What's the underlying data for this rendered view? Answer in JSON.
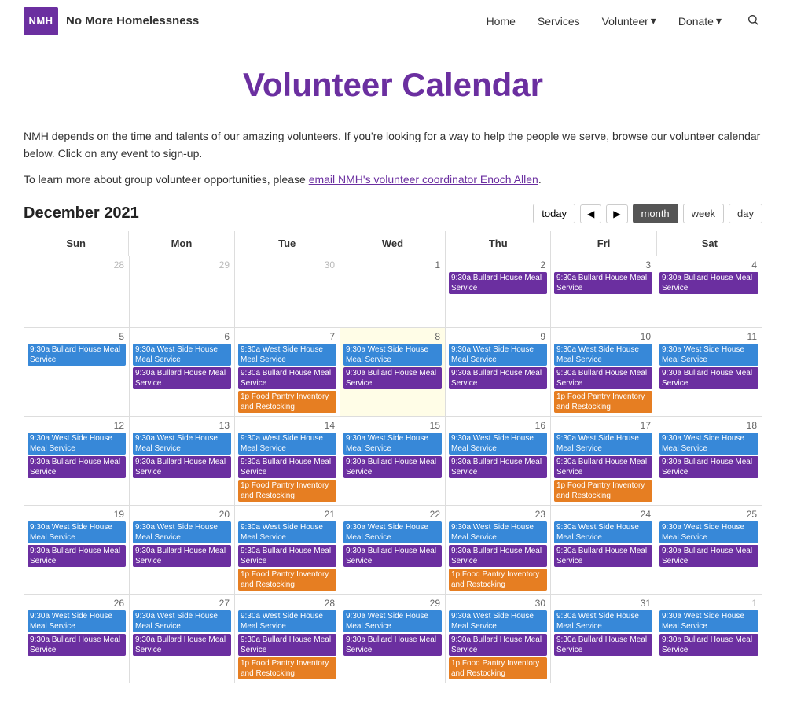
{
  "header": {
    "logo_text": "NMH",
    "site_title": "No More Homelessness",
    "nav": {
      "home": "Home",
      "services": "Services",
      "volunteer": "Volunteer",
      "donate": "Donate"
    }
  },
  "page": {
    "title": "Volunteer Calendar",
    "description1": "NMH depends on the time and talents of our amazing volunteers. If you're looking for a way to help the people we serve, browse our volunteer calendar below. Click on any event to sign-up.",
    "description2": "To learn more about group volunteer opportunities, please",
    "email_link_text": "email NMH's volunteer coordinator Enoch Allen",
    "description2_end": "."
  },
  "calendar": {
    "month_title": "December 2021",
    "today_btn": "today",
    "month_btn": "month",
    "week_btn": "week",
    "day_btn": "day",
    "day_headers": [
      "Sun",
      "Mon",
      "Tue",
      "Wed",
      "Thu",
      "Fri",
      "Sat"
    ],
    "event_types": {
      "bullard": "9:30a Bullard House Meal Service",
      "westside": "9:30a West Side House Meal Service",
      "food_pantry": "1p Food Pantry Inventory and Restocking"
    }
  }
}
